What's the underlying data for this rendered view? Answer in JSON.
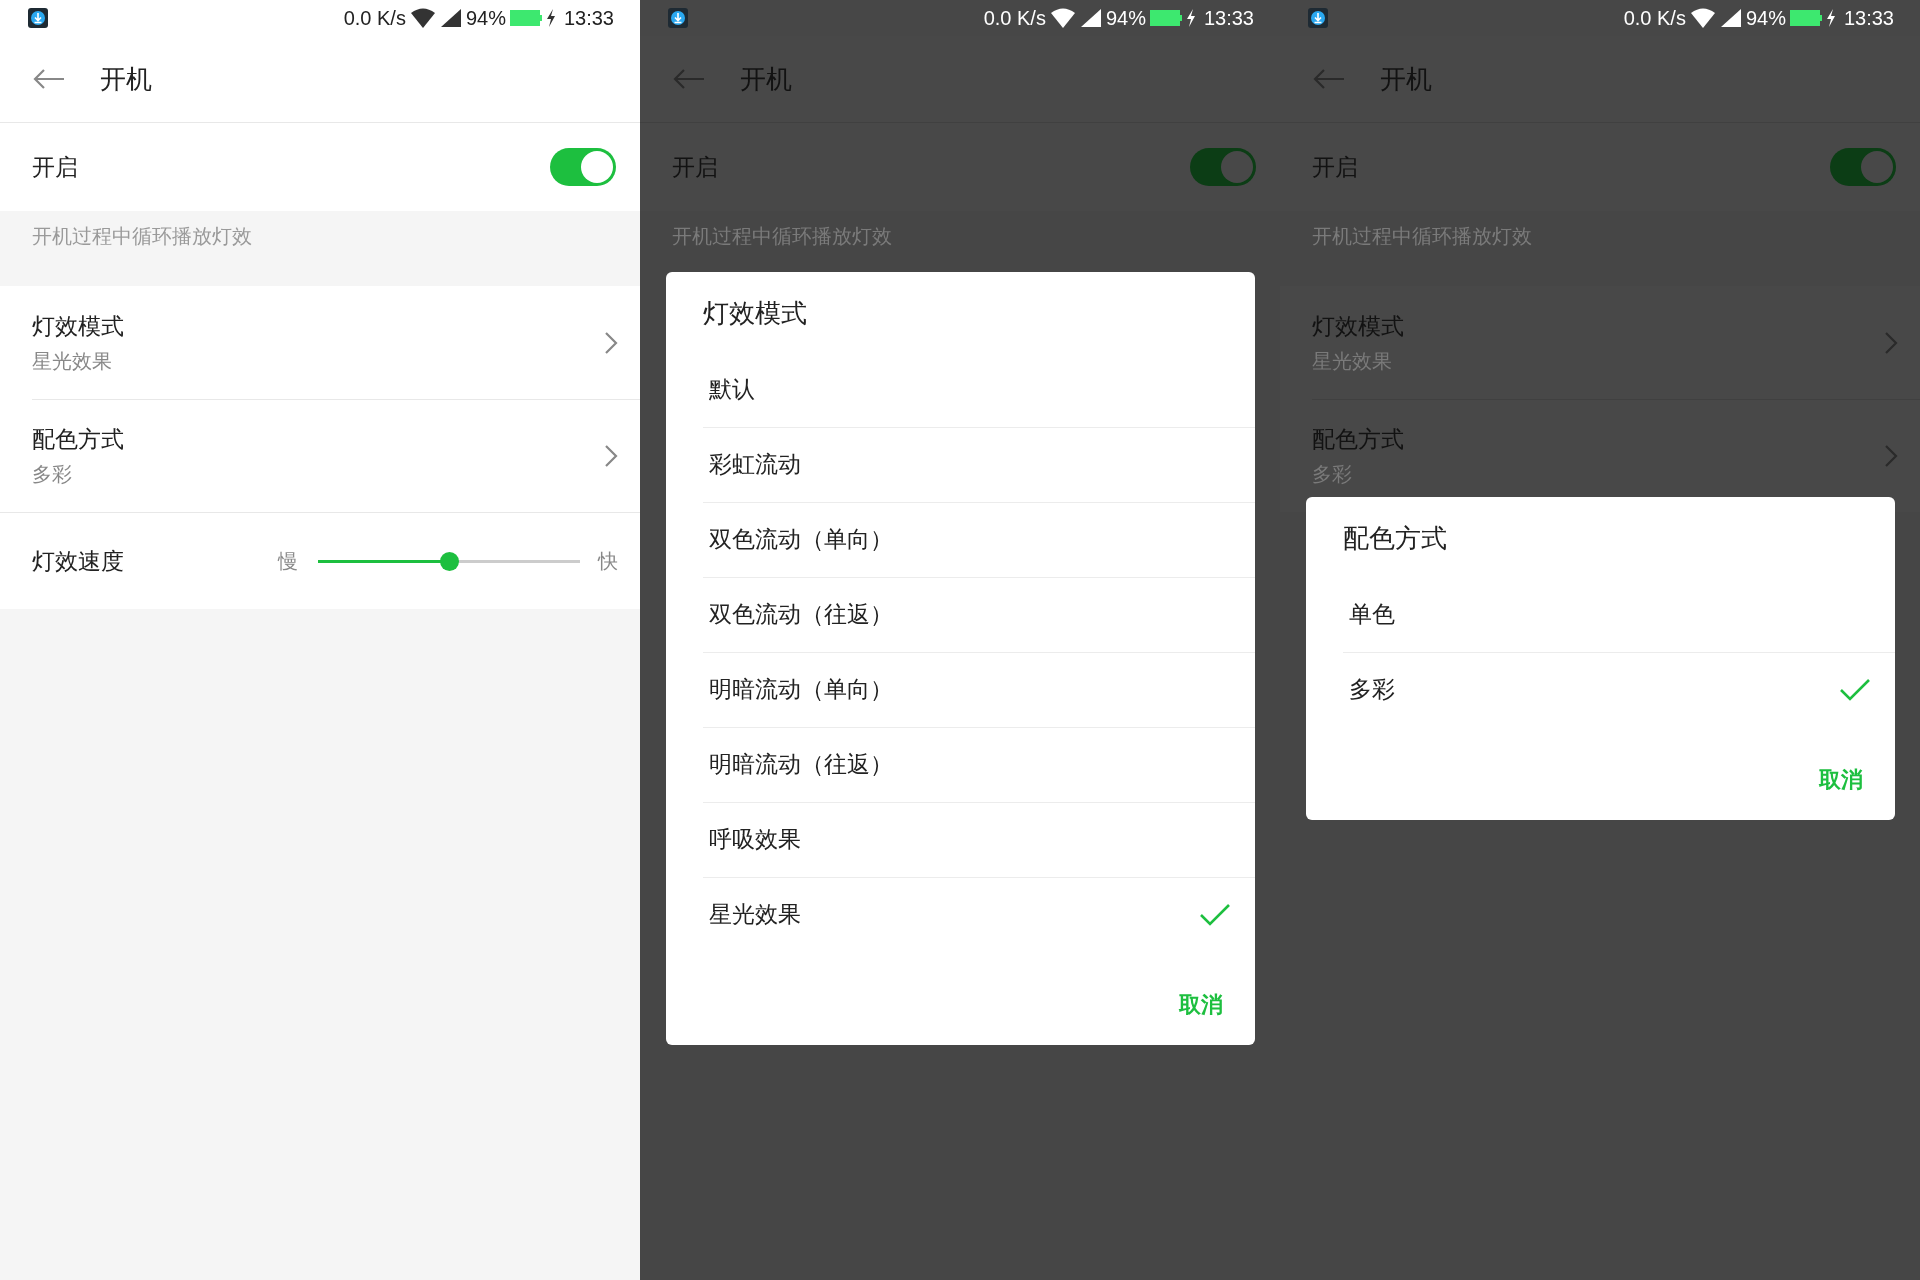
{
  "screens": [
    {
      "status_bar": {
        "speed": "0.0 K/s",
        "battery": "94%",
        "time": "13:33"
      },
      "title": "开机",
      "toggle": {
        "label": "开启",
        "on": true
      },
      "description": "开机过程中循环播放灯效",
      "rows": [
        {
          "title": "灯效模式",
          "value": "星光效果"
        },
        {
          "title": "配色方式",
          "value": "多彩"
        }
      ],
      "speed": {
        "label": "灯效速度",
        "min_label": "慢",
        "max_label": "快",
        "level": 0.5
      }
    },
    {
      "status_bar": {
        "speed": "0.0 K/s",
        "battery": "94%",
        "time": "13:33"
      },
      "title": "开机",
      "toggle": {
        "label": "开启",
        "on": true
      },
      "description": "开机过程中循环播放灯效",
      "dialog": {
        "title": "灯效模式",
        "options": [
          {
            "label": "默认",
            "selected": false
          },
          {
            "label": "彩虹流动",
            "selected": false
          },
          {
            "label": "双色流动（单向）",
            "selected": false
          },
          {
            "label": "双色流动（往返）",
            "selected": false
          },
          {
            "label": "明暗流动（单向）",
            "selected": false
          },
          {
            "label": "明暗流动（往返）",
            "selected": false
          },
          {
            "label": "呼吸效果",
            "selected": false
          },
          {
            "label": "星光效果",
            "selected": true
          }
        ],
        "cancel": "取消"
      }
    },
    {
      "status_bar": {
        "speed": "0.0 K/s",
        "battery": "94%",
        "time": "13:33"
      },
      "title": "开机",
      "toggle": {
        "label": "开启",
        "on": true
      },
      "description": "开机过程中循环播放灯效",
      "rows": [
        {
          "title": "灯效模式",
          "value": "星光效果"
        },
        {
          "title": "配色方式",
          "value": "多彩"
        }
      ],
      "dialog": {
        "title": "配色方式",
        "options": [
          {
            "label": "单色",
            "selected": false
          },
          {
            "label": "多彩",
            "selected": true
          }
        ],
        "cancel": "取消"
      }
    }
  ]
}
